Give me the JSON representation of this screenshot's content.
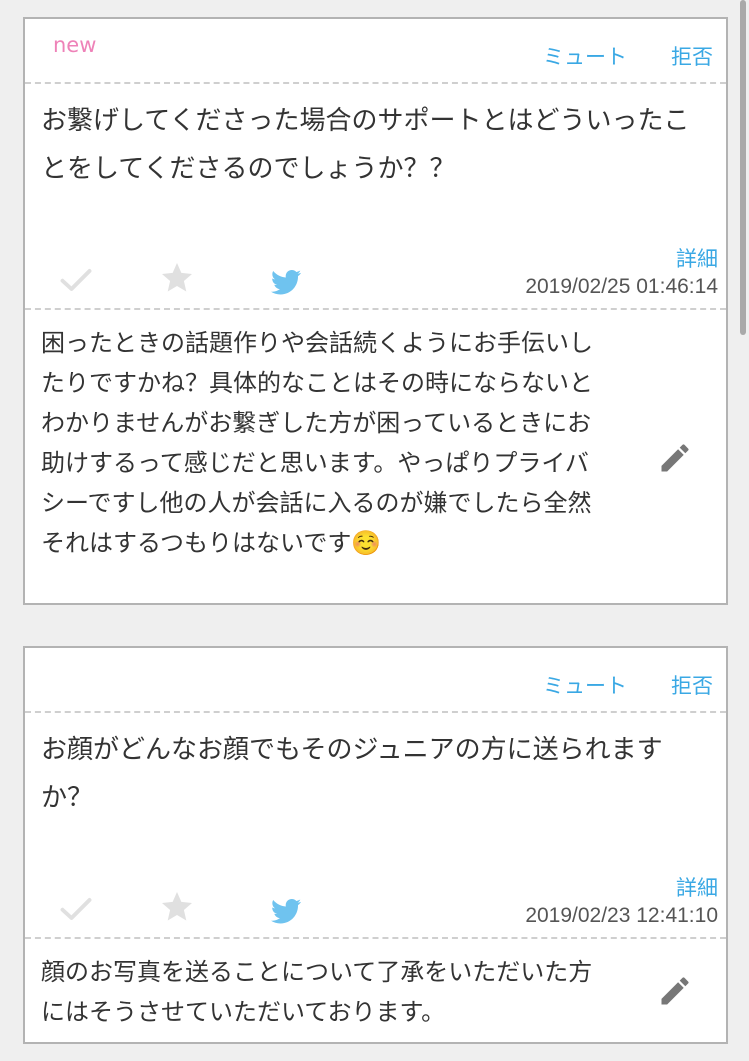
{
  "posts": [
    {
      "badge": "new",
      "mute_label": "ミュート",
      "reject_label": "拒否",
      "question": "お繋げしてくださった場合のサポートとはどういったことをしてくださるのでしょうか？？",
      "detail_label": "詳細",
      "timestamp": "2019/02/25 01:46:14",
      "answer": "困ったときの話題作りや会話続くようにお手伝いしたりですかね？具体的なことはその時にならないとわかりませんがお繋ぎした方が困っているときにお助けするって感じだと思います。やっぱりプライバシーですし他の人が会話に入るのが嫌でしたら全然それはするつもりはないです",
      "answer_emoji": "☺️"
    },
    {
      "mute_label": "ミュート",
      "reject_label": "拒否",
      "question": "お顔がどんなお顔でもそのジュニアの方に送られますか？",
      "detail_label": "詳細",
      "timestamp": "2019/02/23 12:41:10",
      "answer": "顔のお写真を送ることについて了承をいただいた方にはそうさせていただいております。"
    }
  ],
  "colors": {
    "new_badge": "#ee82b8",
    "link": "#3aa8e4",
    "icon_inactive": "#e0e0e0",
    "twitter": "#6fc3ef",
    "pencil": "#777777"
  },
  "icons": [
    "check-icon",
    "star-icon",
    "twitter-icon",
    "pencil-icon"
  ]
}
